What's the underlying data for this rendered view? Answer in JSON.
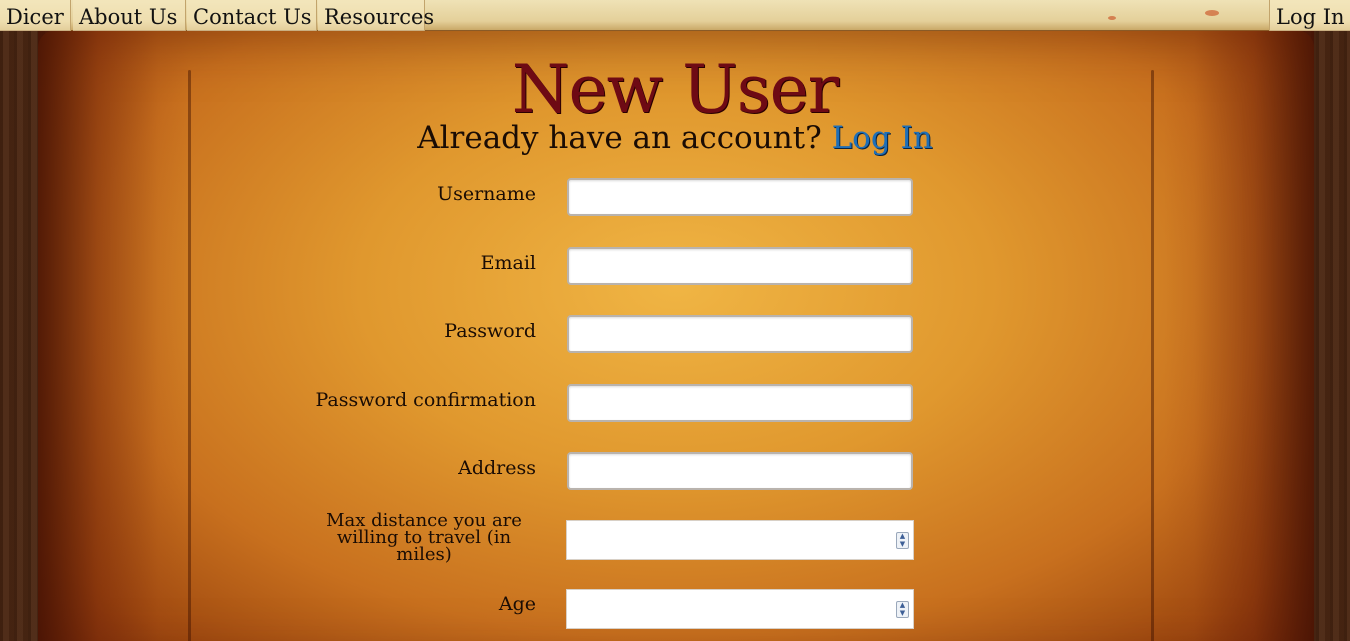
{
  "nav": {
    "brand": "Dicer",
    "about": "About Us",
    "contact": "Contact Us",
    "resources": "Resources",
    "login": "Log In"
  },
  "page": {
    "title": "New User",
    "subtitle_prefix": "Already have an account?",
    "subtitle_link": "Log In"
  },
  "form": {
    "username_label": "Username",
    "username_value": "",
    "email_label": "Email",
    "email_value": "",
    "password_label": "Password",
    "password_value": "",
    "password_confirmation_label": "Password confirmation",
    "password_confirmation_value": "",
    "address_label": "Address",
    "address_value": "",
    "max_distance_label": "Max distance you are willing to travel (in miles)",
    "max_distance_value": "",
    "age_label": "Age",
    "age_value": ""
  },
  "colors": {
    "title": "#6e0a14",
    "link": "#1f6fb7",
    "text": "#1a0c04"
  }
}
